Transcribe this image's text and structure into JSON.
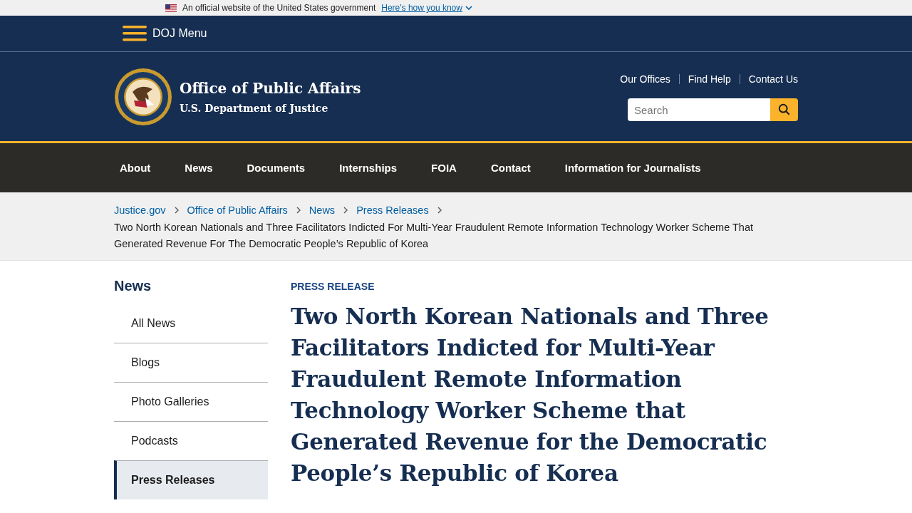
{
  "gov_banner": {
    "text": "An official website of the United States government",
    "link": "Here's how you know"
  },
  "menu_button": {
    "label": "DOJ Menu"
  },
  "site": {
    "title": "Office of Public Affairs",
    "subtitle": "U.S. Department of Justice"
  },
  "utility_links": [
    "Our Offices",
    "Find Help",
    "Contact Us"
  ],
  "search": {
    "placeholder": "Search"
  },
  "nav": [
    {
      "label": "About",
      "selected": false
    },
    {
      "label": "News",
      "selected": false
    },
    {
      "label": "Documents",
      "selected": false
    },
    {
      "label": "Internships",
      "selected": false
    },
    {
      "label": "FOIA",
      "selected": false
    },
    {
      "label": "Contact",
      "selected": false
    },
    {
      "label": "Information for Journalists",
      "selected": false
    }
  ],
  "breadcrumb": {
    "links": [
      "Justice.gov",
      "Office of Public Affairs",
      "News",
      "Press Releases"
    ],
    "current": "Two North Korean Nationals and Three Facilitators Indicted For Multi-Year Fraudulent Remote Information Technology Worker Scheme That Generated Revenue For The Democratic People’s Republic of Korea"
  },
  "sidebar": {
    "heading": "News",
    "items": [
      {
        "label": "All News",
        "selected": false
      },
      {
        "label": "Blogs",
        "selected": false
      },
      {
        "label": "Photo Galleries",
        "selected": false
      },
      {
        "label": "Podcasts",
        "selected": false
      },
      {
        "label": "Press Releases",
        "selected": true
      }
    ]
  },
  "article": {
    "kicker": "PRESS RELEASE",
    "title": "Two North Korean Nationals and Three Facilitators Indicted for Multi-Year Fraudulent Remote Information Technology Worker Scheme that Generated Revenue for the Democratic People’s Republic of Korea"
  }
}
